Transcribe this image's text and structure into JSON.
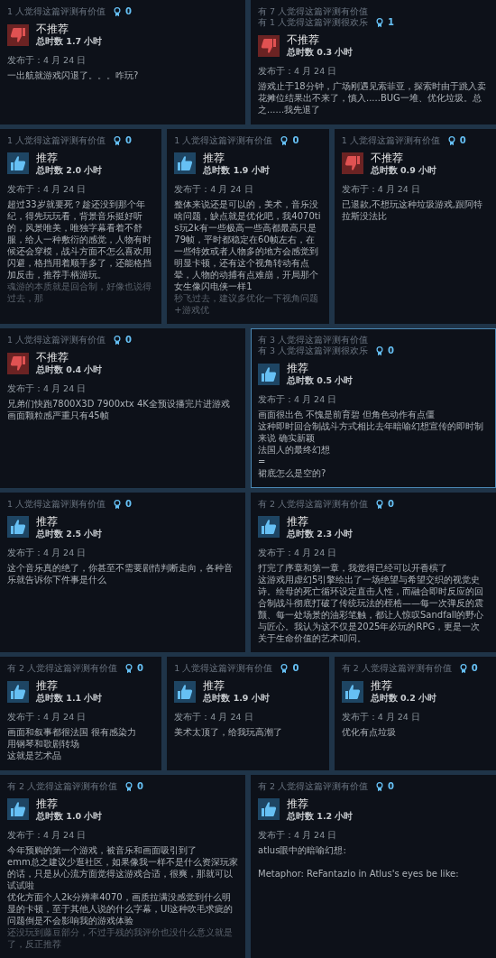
{
  "rows": [
    {
      "reviews": [
        {
          "selected": false,
          "helpful": [
            "1 人觉得这篇评测有价值"
          ],
          "awards": "0",
          "recommended": false,
          "verdict": "不推荐",
          "hours": "总时数 1.7 小时",
          "date": "发布于：4 月 24 日",
          "body": [
            [
              "一出航就游戏闪退了。。。咋玩?"
            ]
          ]
        },
        {
          "selected": false,
          "helpful": [
            "有 7 人觉得这篇评测有价值",
            "有 1 人觉得这篇评测很欢乐"
          ],
          "awards": "1",
          "recommended": false,
          "verdict": "不推荐",
          "hours": "总时数 0.3 小时",
          "date": "发布于：4 月 24 日",
          "body": [
            [
              "游戏止于18分钟，广场刚遇见索菲亚，探索时由于跳入卖花摊位结果出不来了，慎入.....BUG一堆、优化垃圾。总之......我先退了"
            ]
          ]
        }
      ]
    },
    {
      "reviews": [
        {
          "selected": false,
          "helpful": [
            "1 人觉得这篇评测有价值"
          ],
          "awards": "0",
          "recommended": true,
          "verdict": "推荐",
          "hours": "总时数 2.0 小时",
          "date": "发布于：4 月 24 日",
          "body": [
            [
              "超过33岁就要死？趁还没到那个年纪，得先玩玩看，背景音乐挺好听的，风景唯美，唯独字幕看着不舒服，给人一种敷衍的感觉，人物有时候还会穿模，战斗方面不怎么喜欢用闪避，格挡用着顺手多了，还能格挡加反击，推荐手柄游玩。"
            ]
          ],
          "faded": "魂游的本质就是回合制，好像也说得过去，那"
        },
        {
          "selected": false,
          "helpful": [
            "1 人觉得这篇评测有价值"
          ],
          "awards": "0",
          "recommended": true,
          "verdict": "推荐",
          "hours": "总时数 1.9 小时",
          "date": "发布于：4 月 24 日",
          "body": [
            [
              "整体来说还是可以的，美术，音乐没啥问题，缺点就是优化吧，我4070tis玩2k有一些极高一些高都最高只是79帧，平时都稳定在60帧左右，在一些特效或者人物多的地方会感觉到明显卡顿，还有这个视角转动有点晕，人物的动捕有点难崩，开局那个女生像闪电侠一样1"
            ]
          ],
          "faded": "秒飞过去，建议多优化一下视角问题+游戏优"
        },
        {
          "selected": false,
          "helpful": [
            "1 人觉得这篇评测有价值"
          ],
          "awards": "0",
          "recommended": false,
          "verdict": "不推荐",
          "hours": "总时数 0.9 小时",
          "date": "发布于：4 月 24 日",
          "body": [
            [
              "已退款,不想玩这种垃圾游戏,跟阿特拉斯没法比"
            ]
          ]
        }
      ]
    },
    {
      "reviews": [
        {
          "selected": false,
          "helpful": [
            "1 人觉得这篇评测有价值"
          ],
          "awards": "0",
          "recommended": false,
          "verdict": "不推荐",
          "hours": "总时数 0.4 小时",
          "date": "发布于：4 月 24 日",
          "body": [
            [
              "兄弟们快跑7800X3D 7900xtx 4K全预设播完片进游戏画面颗粒感严重只有45帧"
            ]
          ]
        },
        {
          "selected": true,
          "helpful": [
            "有 3 人觉得这篇评测有价值",
            "有 3 人觉得这篇评测很欢乐"
          ],
          "awards": "0",
          "recommended": true,
          "verdict": "推荐",
          "hours": "总时数 0.5 小时",
          "date": "发布于：4 月 24 日",
          "body": [
            [
              "画面很出色 不愧是前育碧 但角色动作有点僵",
              "这种即时回合制战斗方式相比去年暗喻幻想宣传的即时制来说 确实新颖",
              "法国人的最终幻想",
              "=",
              "裙底怎么是空的?"
            ]
          ]
        }
      ]
    },
    {
      "reviews": [
        {
          "selected": false,
          "helpful": [
            "1 人觉得这篇评测有价值"
          ],
          "awards": "0",
          "recommended": true,
          "verdict": "推荐",
          "hours": "总时数 2.5 小时",
          "date": "发布于：4 月 24 日",
          "body": [
            [
              "这个音乐真的绝了，你甚至不需要剧情判断走向，各种音乐就告诉你下件事是什么"
            ]
          ]
        },
        {
          "selected": false,
          "helpful": [
            "有 2 人觉得这篇评测有价值"
          ],
          "awards": "0",
          "recommended": true,
          "verdict": "推荐",
          "hours": "总时数 2.3 小时",
          "date": "发布于：4 月 24 日",
          "body": [
            [
              "打完了序章和第一章，我觉得已经可以开香槟了",
              "这游戏用虚幻5引擎绘出了一场绝望与希望交织的视觉史诗。绘母的死亡循环设定直击人性，而融合即时反应的回合制战斗彻底打破了传统玩法的桎梏——每一次弹反的震颤、每一处场景的油彩笔触，都让人惊叹Sandfall的野心与匠心。我认为这不仅是2025年必玩的RPG，更是一次关于生命价值的艺术叩问。"
            ]
          ]
        }
      ]
    },
    {
      "reviews": [
        {
          "selected": false,
          "helpful": [
            "有 2 人觉得这篇评测有价值"
          ],
          "awards": "0",
          "recommended": true,
          "verdict": "推荐",
          "hours": "总时数 1.1 小时",
          "date": "发布于：4 月 24 日",
          "body": [
            [
              "画面和叙事都很法国 很有感染力",
              "用钢琴和歌剧转场",
              "这就是艺术品"
            ]
          ]
        },
        {
          "selected": false,
          "helpful": [
            "1 人觉得这篇评测有价值"
          ],
          "awards": "0",
          "recommended": true,
          "verdict": "推荐",
          "hours": "总时数 1.9 小时",
          "date": "发布于：4 月 24 日",
          "body": [
            [
              "美术太顶了，给我玩高潮了"
            ]
          ]
        },
        {
          "selected": false,
          "helpful": [
            "有 2 人觉得这篇评测有价值"
          ],
          "awards": "0",
          "recommended": true,
          "verdict": "推荐",
          "hours": "总时数 0.2 小时",
          "date": "发布于：4 月 24 日",
          "body": [
            [
              "优化有点垃圾"
            ]
          ]
        }
      ]
    },
    {
      "reviews": [
        {
          "selected": false,
          "helpful": [
            "有 2 人觉得这篇评测有价值"
          ],
          "awards": "0",
          "recommended": true,
          "verdict": "推荐",
          "hours": "总时数 1.0 小时",
          "date": "发布于：4 月 24 日",
          "body": [
            [
              "今年预购的第一个游戏，被音乐和画面吸引到了",
              "emm总之建议少逛社区，如果像我一样不是什么资深玩家的话，只是从心流方面觉得这游戏合适，很爽，那就可以试试啦",
              "优化方面个人2k分辨率4070，画质拉满没感觉到什么明显的卡顿，至于其他人说的什么字幕，UI这种吹毛求疵的问题倒是不会影响我的游戏体验"
            ]
          ],
          "faded": "还没玩到藤豆部分，不过手残的我评价也没什么意义就是了，反正推荐"
        },
        {
          "selected": false,
          "helpful": [
            "有 2 人觉得这篇评测有价值"
          ],
          "awards": "0",
          "recommended": true,
          "verdict": "推荐",
          "hours": "总时数 1.2 小时",
          "date": "发布于：4 月 24 日",
          "body": [
            [
              "atlus眼中的暗喻幻想:"
            ],
            [
              "Metaphor: ReFantazio in Atlus's eyes be like:"
            ]
          ]
        }
      ]
    }
  ]
}
